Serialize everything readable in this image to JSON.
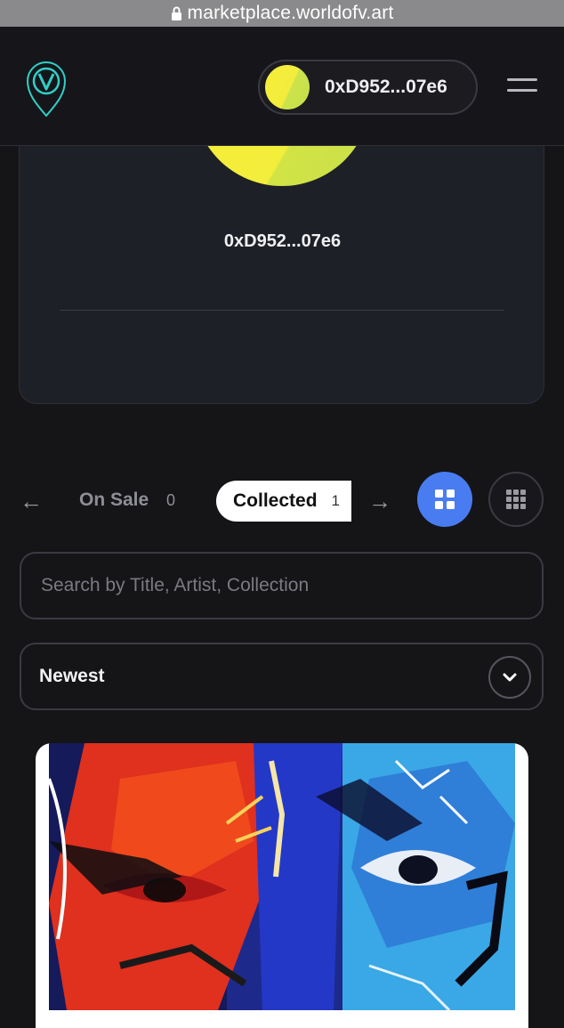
{
  "browser": {
    "url": "marketplace.worldofv.art"
  },
  "header": {
    "logo_letter": "V",
    "wallet_address": "0xD952...07e6"
  },
  "profile": {
    "address": "0xD952...07e6"
  },
  "tabs": {
    "on_sale_label": "On Sale",
    "on_sale_count": "0",
    "collected_label": "Collected",
    "collected_count": "1",
    "prev_arrow": "←",
    "next_arrow": "→"
  },
  "search": {
    "placeholder": "Search by Title, Artist, Collection",
    "value": ""
  },
  "sort": {
    "selected": "Newest"
  },
  "colors": {
    "accent": "#4a7cf1",
    "avatar": "#f6ef38",
    "background": "#151518"
  },
  "icons": {
    "lock": "lock-icon",
    "menu": "hamburger-menu-icon",
    "grid_large": "grid-large-icon",
    "grid_small": "grid-small-icon",
    "chevron": "chevron-down-icon"
  }
}
